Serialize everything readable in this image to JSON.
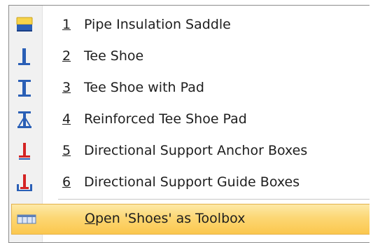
{
  "menu": {
    "items": [
      {
        "number": "1",
        "label": "Pipe Insulation Saddle",
        "icon": "pipe-insulation-saddle-icon"
      },
      {
        "number": "2",
        "label": "Tee Shoe",
        "icon": "tee-shoe-icon"
      },
      {
        "number": "3",
        "label": "Tee Shoe with Pad",
        "icon": "tee-shoe-with-pad-icon"
      },
      {
        "number": "4",
        "label": "Reinforced Tee Shoe Pad",
        "icon": "reinforced-tee-shoe-pad-icon"
      },
      {
        "number": "5",
        "label": "Directional Support Anchor Boxes",
        "icon": "anchor-boxes-icon"
      },
      {
        "number": "6",
        "label": "Directional Support Guide Boxes",
        "icon": "guide-boxes-icon"
      }
    ],
    "toolbox": {
      "mnemonic": "O",
      "label_rest": "pen 'Shoes' as Toolbox",
      "icon": "toolbox-icon"
    }
  },
  "colors": {
    "icon_blue": "#2a5fb6",
    "icon_red": "#d42424",
    "highlight": "#fcd774"
  }
}
